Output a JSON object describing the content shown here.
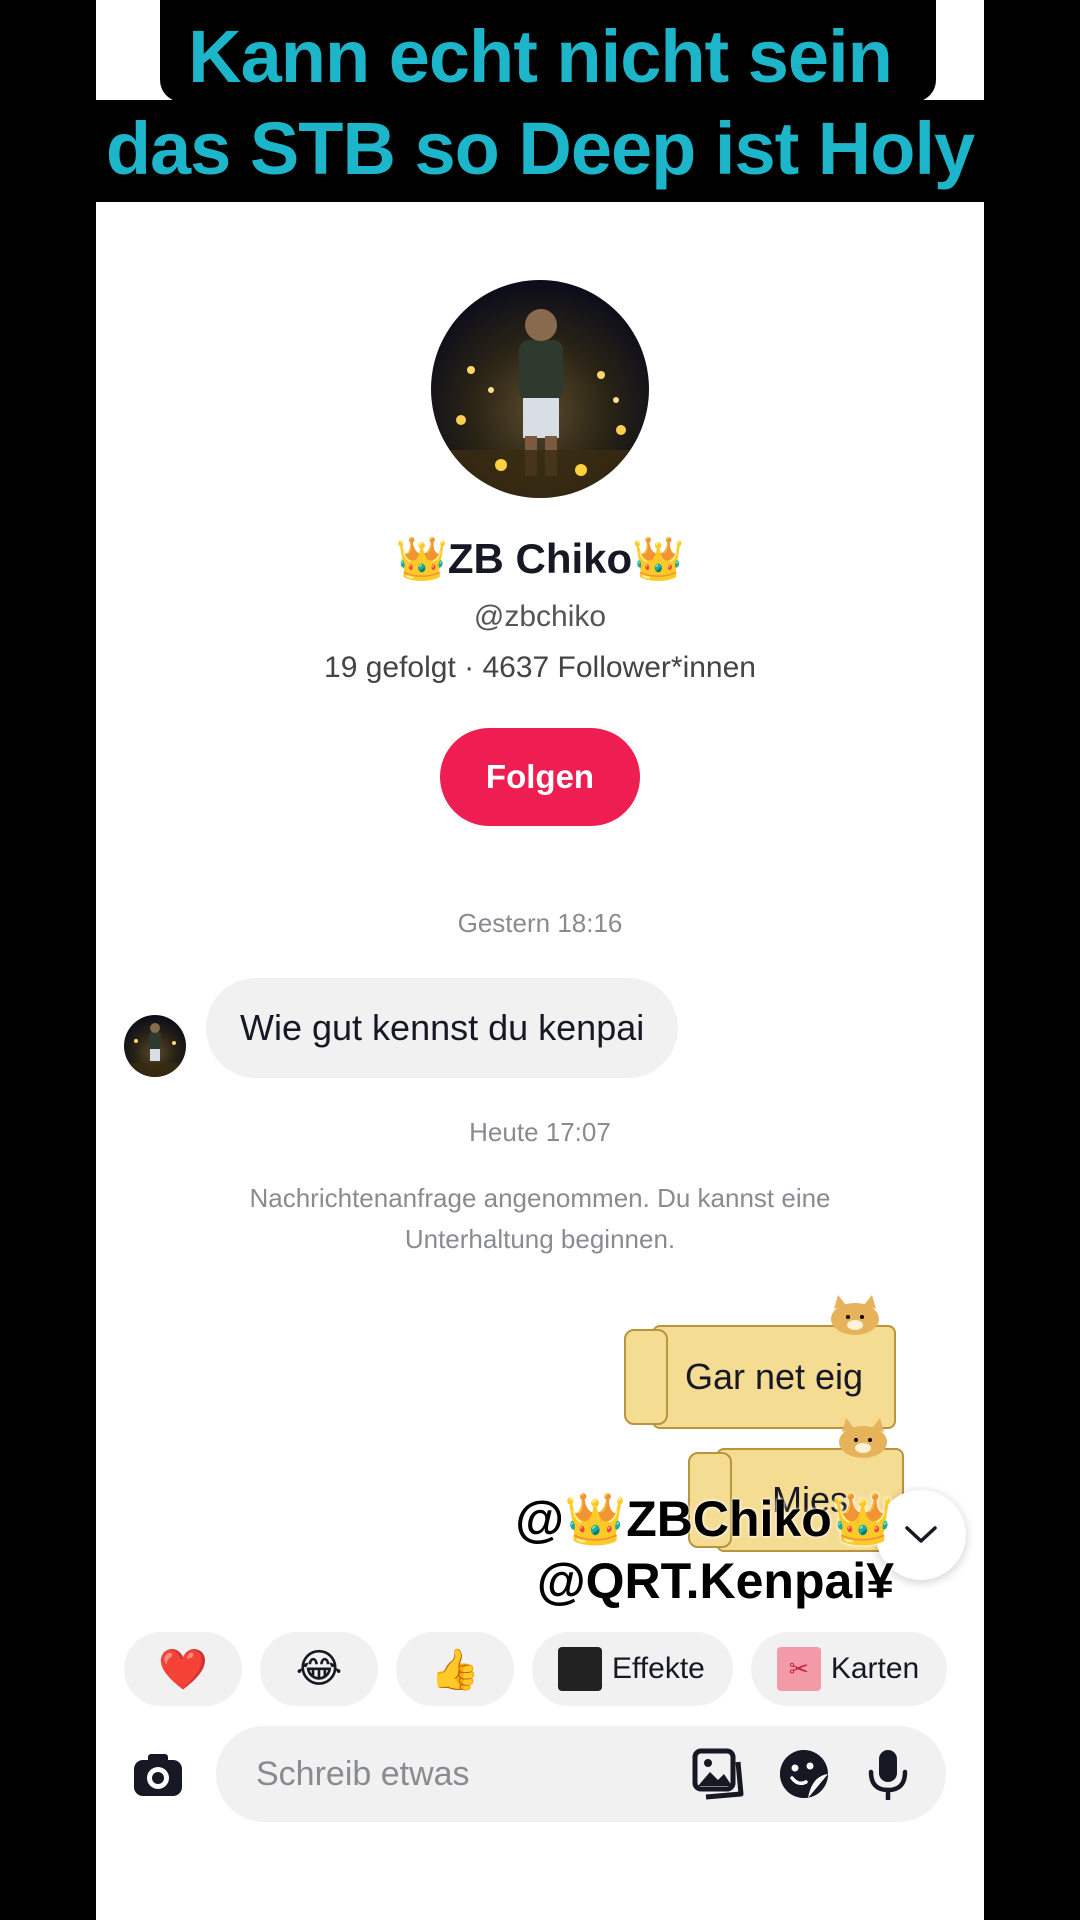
{
  "caption": {
    "line1": "Kann echt nicht sein",
    "line2": "das STB so Deep ist Holy"
  },
  "profile": {
    "name": "👑ZB Chiko👑",
    "handle": "@zbchiko",
    "stats": "19 gefolgt · 4637 Follower*innen",
    "follow_label": "Folgen"
  },
  "chat": {
    "timestamp1": "Gestern 18:16",
    "incoming_message": "Wie gut kennst du kenpai",
    "timestamp2": "Heute 17:07",
    "system_message": "Nachrichtenanfrage angenommen. Du kannst eine Unterhaltung beginnen.",
    "outgoing1": "Gar net eig",
    "outgoing2": "Mies"
  },
  "overlay": {
    "tag1": "@👑ZBChiko👑",
    "tag2": "@QRT.Kenpai¥"
  },
  "quick_reactions": {
    "heart": "❤️",
    "laugh": "😂",
    "thumbs": "👍",
    "effects_label": "Effekte",
    "cards_label": "Karten"
  },
  "composer": {
    "placeholder": "Schreib etwas"
  },
  "colors": {
    "caption": "#1cb5c9",
    "follow_button": "#ee1d52",
    "doge_card": "#f5dc93"
  }
}
